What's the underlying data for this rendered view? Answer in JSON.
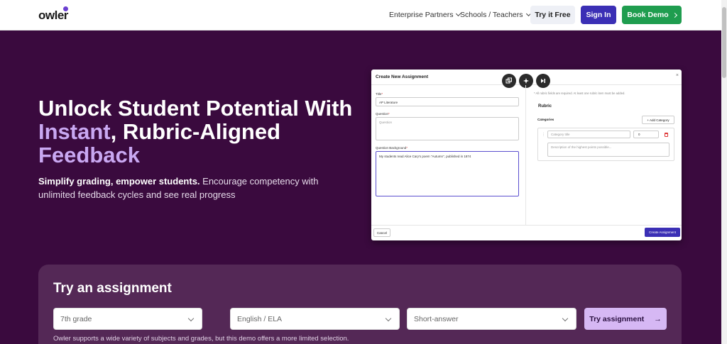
{
  "nav": {
    "logo": "owler",
    "links": [
      "Enterprise Partners",
      "Schools / Teachers"
    ],
    "try_free": "Try it Free",
    "sign_in": "Sign In",
    "book_demo": "Book Demo"
  },
  "hero": {
    "title_pre": "Unlock Student Potential With ",
    "title_highlight": "Instant",
    "title_mid": ", Rubric-Aligned ",
    "title_highlight2": "Feedback",
    "sub_bold": "Simplify grading, empower students.",
    "sub_rest": " Encourage competency with unlimited feedback cycles and see real progress"
  },
  "modal": {
    "title": "Create New Assignment",
    "close": "×",
    "title_label": "Title",
    "title_value": "AP Literature",
    "question_label": "Question",
    "question_placeholder": "Question",
    "background_label": "Question Background",
    "background_value": "My students read Alice Cary's poem \"Autumn\", published in 1874",
    "note": "* All rubric fields are required. At least one rubric item must be added.",
    "rubric": "Rubric",
    "categories": "Categories",
    "add_category": "+ Add Category",
    "category_title_placeholder": "Category title",
    "category_points": "0",
    "description_placeholder": "Description of the highest points possible...",
    "cancel": "Cancel",
    "create": "Create Assignment"
  },
  "try": {
    "title": "Try an assignment",
    "grade": "7th grade",
    "subject": "English / ELA",
    "type": "Short-answer",
    "button": "Try assignment",
    "note": "Owler supports a wide variety of subjects and grades, but this demo offers a more limited selection."
  }
}
